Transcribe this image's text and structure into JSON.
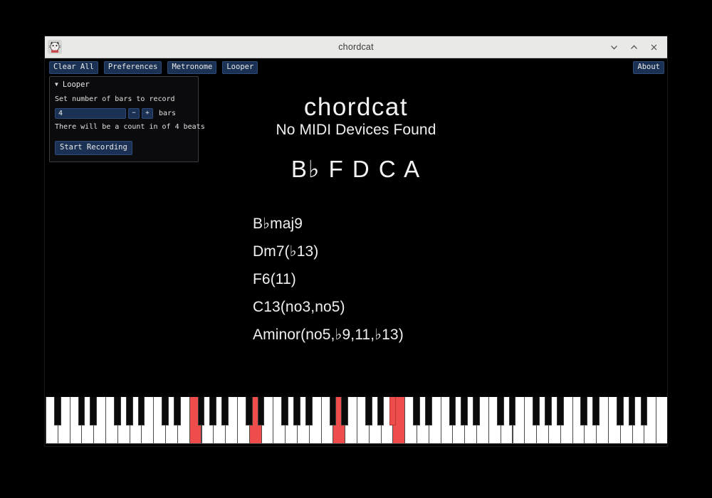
{
  "window": {
    "title": "chordcat",
    "icon": "cat-face-icon",
    "controls": [
      {
        "name": "minimize-button",
        "glyph": "v"
      },
      {
        "name": "maximize-button",
        "glyph": "^"
      },
      {
        "name": "close-button",
        "glyph": "x"
      }
    ]
  },
  "toolbar": {
    "clear_all": "Clear All",
    "preferences": "Preferences",
    "metronome": "Metronome",
    "looper": "Looper",
    "about": "About"
  },
  "looper": {
    "caret": "▼",
    "title": "Looper",
    "bars_prompt": "Set number of bars to record",
    "bars_value": "4",
    "decrement_label": "−",
    "increment_label": "+",
    "bars_unit": "bars",
    "count_in_text": "There will be a count in of 4 beats",
    "start_recording": "Start Recording"
  },
  "main": {
    "brand": "chordcat",
    "midi_status": "No MIDI Devices Found",
    "notes": "B♭ F D C A",
    "chords": [
      "B♭maj9",
      "Dm7(♭13)",
      "F6(11)",
      "C13(no3,no5)",
      "Aminor(no5,♭9,11,♭13)"
    ]
  },
  "piano": {
    "white_key_count": 52,
    "active_white_indices": [
      12,
      17,
      24,
      29
    ],
    "active_black_semitone": 70,
    "active_color": "#ef4c4c",
    "white_color": "#ffffff",
    "black_color": "#0a0a0a"
  },
  "colors": {
    "background": "#000000",
    "titlebar": "#e9e9e7",
    "button": "#1b3153",
    "accent_red": "#ef4c4c",
    "text": "#f2f2f2"
  }
}
